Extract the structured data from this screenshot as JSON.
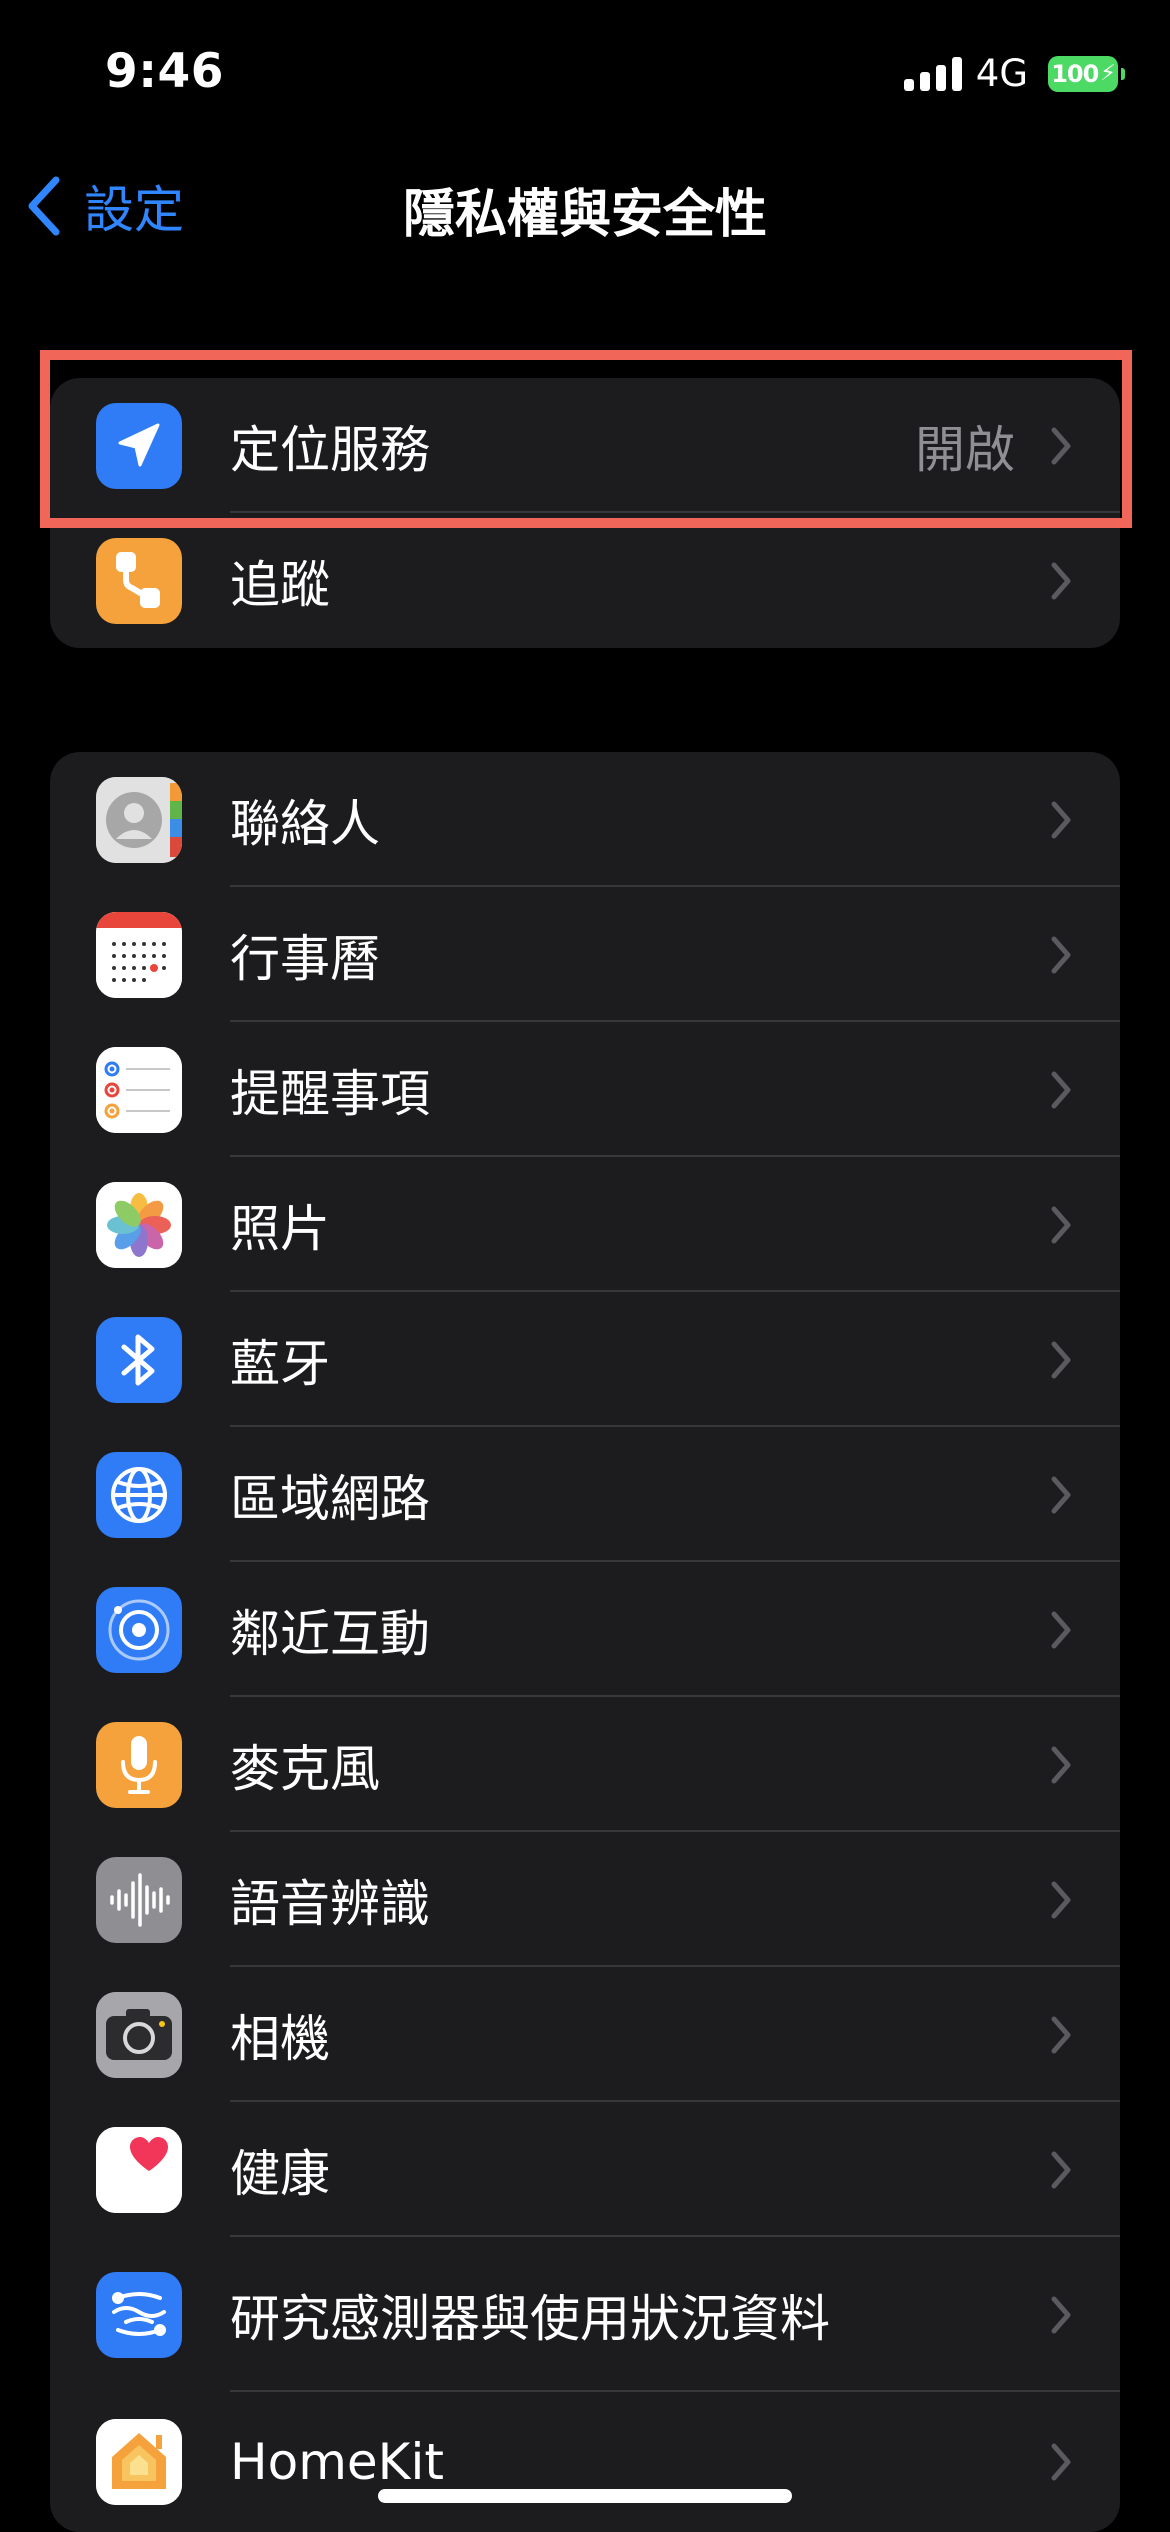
{
  "status_bar": {
    "time": "9:46",
    "network": "4G",
    "battery": "100"
  },
  "nav": {
    "back_label": "設定",
    "title": "隱私權與安全性"
  },
  "group_1": [
    {
      "label": "定位服務",
      "value": "開啟",
      "icon": "location-arrow-icon",
      "color": "#2f7cf6"
    },
    {
      "label": "追蹤",
      "icon": "tracking-icon",
      "color": "#f5a23c"
    }
  ],
  "group_2": [
    {
      "label": "聯絡人",
      "icon": "contacts-icon"
    },
    {
      "label": "行事曆",
      "icon": "calendar-icon"
    },
    {
      "label": "提醒事項",
      "icon": "reminders-icon"
    },
    {
      "label": "照片",
      "icon": "photos-icon"
    },
    {
      "label": "藍牙",
      "icon": "bluetooth-icon",
      "color": "#2f7cf6"
    },
    {
      "label": "區域網路",
      "icon": "globe-icon",
      "color": "#2f7cf6"
    },
    {
      "label": "鄰近互動",
      "icon": "nearby-interaction-icon",
      "color": "#2f7cf6"
    },
    {
      "label": "麥克風",
      "icon": "microphone-icon",
      "color": "#f5a23c"
    },
    {
      "label": "語音辨識",
      "icon": "speech-recognition-icon",
      "color": "#8e8e93"
    },
    {
      "label": "相機",
      "icon": "camera-icon",
      "color": "#8e8e93"
    },
    {
      "label": "健康",
      "icon": "health-heart-icon"
    },
    {
      "label": "研究感測器與使用狀況資料",
      "icon": "research-sensor-icon",
      "color": "#2f7cf6"
    },
    {
      "label": "HomeKit",
      "icon": "homekit-icon"
    }
  ]
}
